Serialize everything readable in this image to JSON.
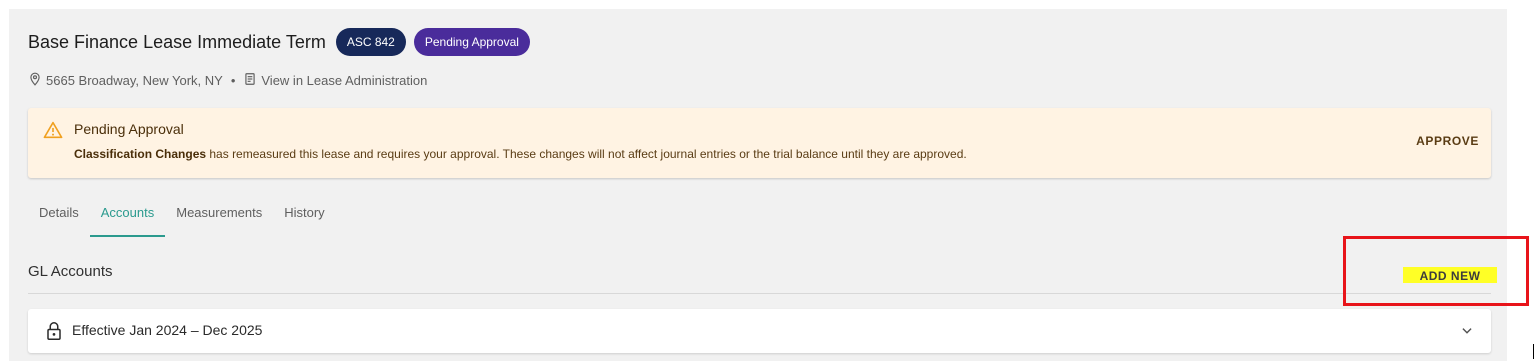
{
  "header": {
    "title": "Base Finance Lease Immediate Term",
    "badges": {
      "standard": "ASC 842",
      "status": "Pending Approval"
    }
  },
  "meta": {
    "address": "5665 Broadway, New York, NY",
    "separator": "•",
    "admin_link": "View in Lease Administration"
  },
  "alert": {
    "title": "Pending Approval",
    "bold_text": "Classification Changes",
    "message": " has remeasured this lease and requires your approval. These changes will not affect journal entries or the trial balance until they are approved.",
    "action": "APPROVE"
  },
  "tabs": [
    {
      "label": "Details"
    },
    {
      "label": "Accounts"
    },
    {
      "label": "Measurements"
    },
    {
      "label": "History"
    }
  ],
  "gl_accounts": {
    "title": "GL Accounts",
    "add_label": "ADD NEW",
    "period_label": "Effective Jan 2024 – Dec 2025"
  },
  "colors": {
    "accent": "#2b9a8e",
    "badge_asc": "#17295a",
    "badge_pending": "#4a2c9b",
    "alert_bg": "#fff3e3",
    "highlight": "#ffff26",
    "annotation_box": "#e8141a"
  },
  "icons": [
    "location-pin-icon",
    "document-icon",
    "warning-icon",
    "lock-icon",
    "chevron-down-icon"
  ]
}
